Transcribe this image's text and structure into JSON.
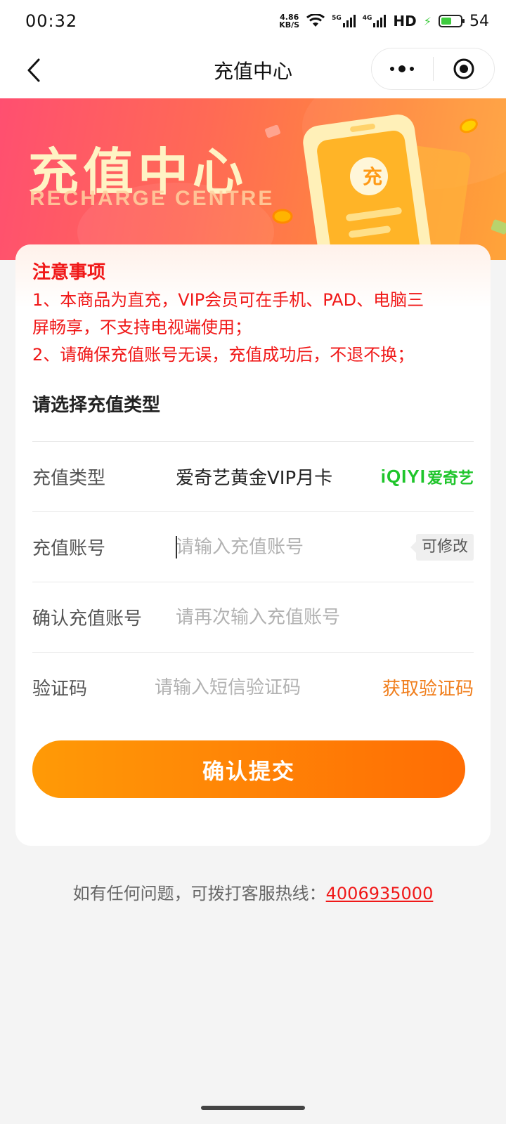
{
  "status_bar": {
    "time": "00:32",
    "net_speed_value": "4.86",
    "net_speed_unit": "KB/S",
    "signal1_label": "5G",
    "signal2_label": "4G",
    "hd_label": "HD",
    "battery": "54"
  },
  "nav": {
    "title": "充值中心"
  },
  "banner": {
    "title": "充值中心",
    "subtitle": "RECHARGE CENTRE",
    "badge": "充"
  },
  "notice": {
    "title": "注意事项",
    "line1": "1、本商品为直充，VIP会员可在手机、PAD、电脑三",
    "line2": "屏畅享，不支持电视端使用；",
    "line3": "2、请确保充值账号无误，充值成功后，不退不换；"
  },
  "form": {
    "section_title": "请选择充值类型",
    "type_label": "充值类型",
    "type_value": "爱奇艺黄金VIP月卡",
    "brand_latin": "iQIYI",
    "brand_cn": "爱奇艺",
    "account_label": "充值账号",
    "account_placeholder": "请输入充值账号",
    "account_tag": "可修改",
    "confirm_label": "确认充值账号",
    "confirm_placeholder": "请再次输入充值账号",
    "code_label": "验证码",
    "code_placeholder": "请输入短信验证码",
    "get_code": "获取验证码"
  },
  "submit_label": "确认提交",
  "footer": {
    "text": "如有任何问题，可拨打客服热线：",
    "phone": "4006935000"
  },
  "colors": {
    "accent_orange": "#ff7a05",
    "notice_red": "#f01818",
    "brand_green": "#1fc52b",
    "link_orange": "#f07d1a"
  }
}
